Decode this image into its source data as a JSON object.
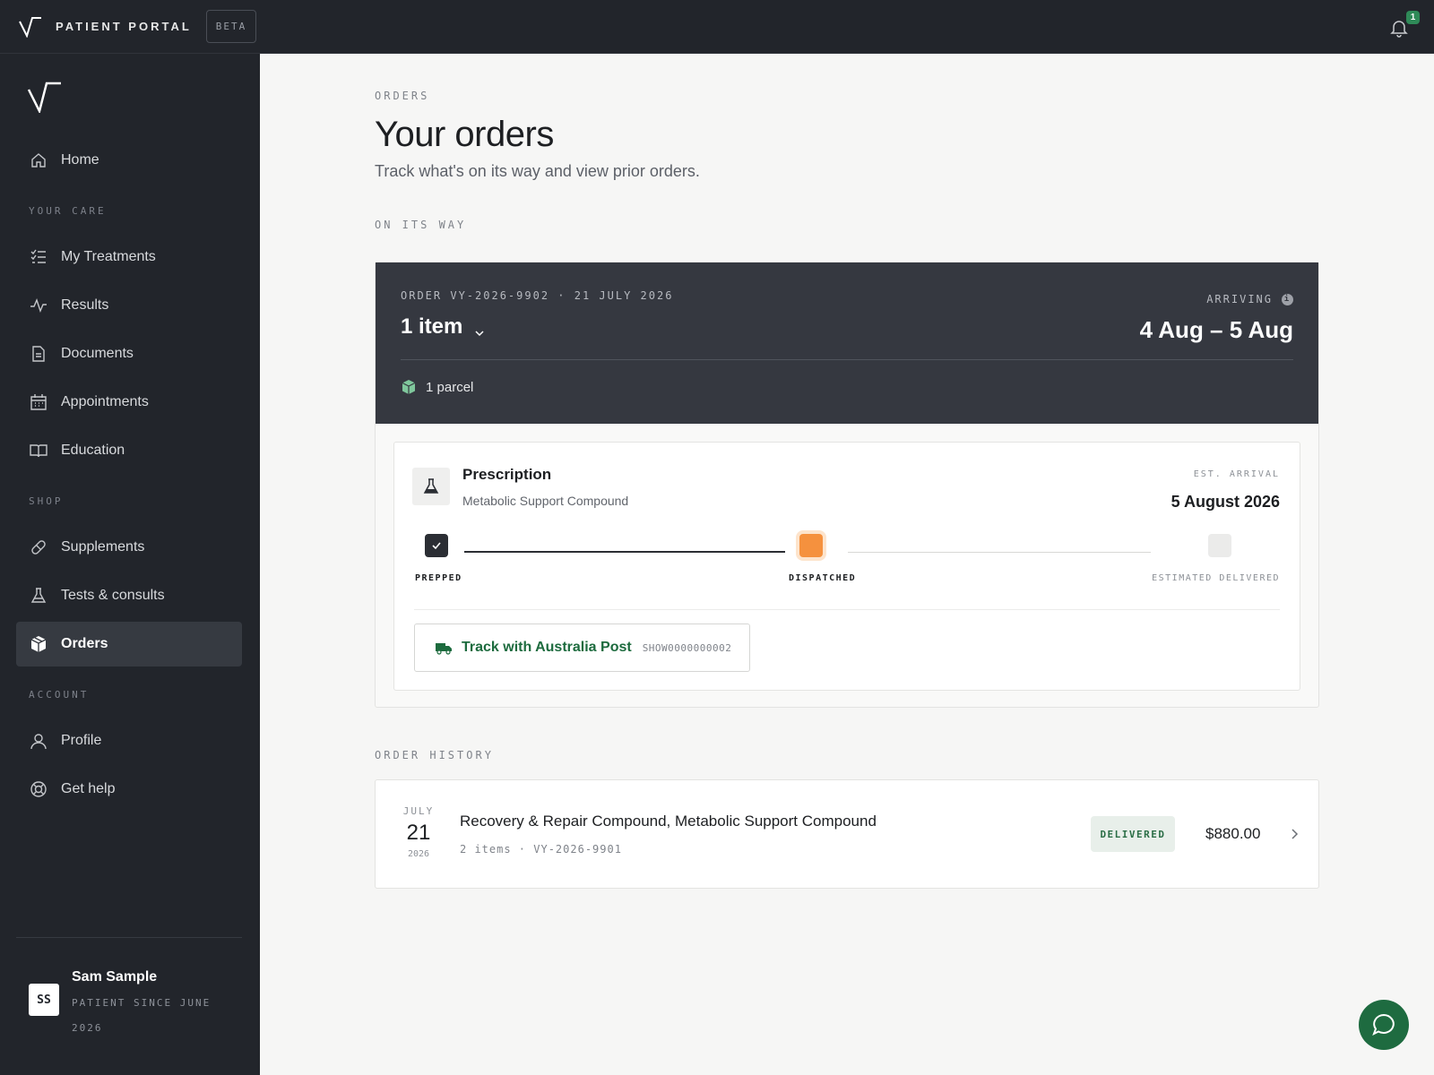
{
  "app": {
    "title": "PATIENT PORTAL",
    "beta_label": "BETA",
    "notification_count": "1"
  },
  "sidebar": {
    "home": "Home",
    "section_care": "YOUR CARE",
    "my_treatments": "My Treatments",
    "results": "Results",
    "documents": "Documents",
    "appointments": "Appointments",
    "education": "Education",
    "section_shop": "SHOP",
    "supplements": "Supplements",
    "tests_consults": "Tests & consults",
    "orders": "Orders",
    "section_account": "ACCOUNT",
    "profile": "Profile",
    "get_help": "Get help",
    "user": {
      "initials": "SS",
      "name": "Sam Sample",
      "since": "PATIENT SINCE JUNE 2026"
    }
  },
  "main": {
    "eyebrow": "ORDERS",
    "title": "Your orders",
    "subtitle": "Track what's on its way and view prior orders.",
    "on_its_way_label": "ON ITS WAY",
    "order_history_label": "ORDER HISTORY"
  },
  "active_order": {
    "meta": "ORDER VY-2026-9902 · 21 JULY 2026",
    "items": "1 item",
    "arriving_label": "ARRIVING",
    "arriving_range": "4 Aug – 5 Aug",
    "parcel": "1 parcel",
    "item": {
      "title": "Prescription",
      "subtitle": "Metabolic Support Compound",
      "est_label": "EST. ARRIVAL",
      "est_date": "5 August 2026"
    },
    "steps": [
      "PREPPED",
      "DISPATCHED",
      "ESTIMATED DELIVERED"
    ],
    "current_step": 2,
    "track_label": "Track with Australia Post",
    "tracking_number": "SHOW0000000002"
  },
  "history": [
    {
      "month": "JULY",
      "day": "21",
      "year": "2026",
      "title": "Recovery & Repair Compound, Metabolic Support Compound",
      "meta": "2 items · VY-2026-9901",
      "status": "DELIVERED",
      "amount": "$880.00"
    }
  ],
  "colors": {
    "accent_green": "#1e6b40",
    "dispatched_orange": "#f5913e",
    "sidebar_bg": "#22252b"
  }
}
